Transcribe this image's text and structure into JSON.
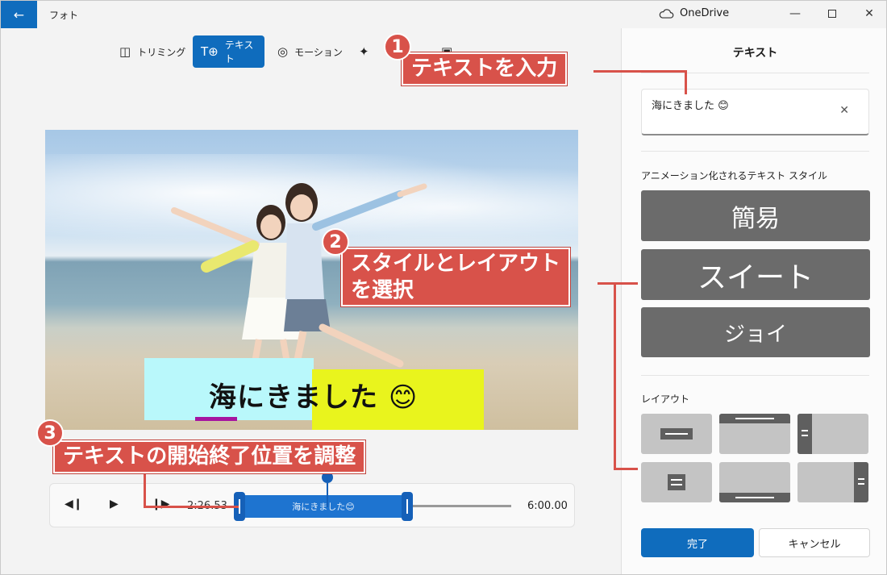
{
  "window": {
    "app_title": "フォト",
    "onedrive_label": "OneDrive"
  },
  "toolbar": {
    "items": [
      {
        "label": "トリミング",
        "icon": "trim-icon",
        "active": false
      },
      {
        "label": "テキスト",
        "icon": "text-icon",
        "active": true
      },
      {
        "label": "モーション",
        "icon": "motion-icon",
        "active": false
      },
      {
        "label": "3D効果",
        "icon": "3d-effects-icon",
        "active": false
      },
      {
        "label": "フィルター",
        "icon": "filter-icon",
        "active": false
      }
    ]
  },
  "preview": {
    "overlay_text": "海にきました",
    "overlay_emoji": "😊",
    "overlay_colors": {
      "left": "#b9f8fb",
      "right": "#e9f41d",
      "underline": "#a614a0"
    }
  },
  "timeline": {
    "current_time": "2:26.53",
    "end_time": "6:00.00",
    "clip_label": "海にきました😊"
  },
  "panel": {
    "title": "テキスト",
    "text_input_value": "海にきました 😊",
    "style_section_label": "アニメーション化されるテキスト スタイル",
    "styles": [
      "簡易",
      "スイート",
      "ジョイ"
    ],
    "layout_section_label": "レイアウト",
    "done_label": "完了",
    "cancel_label": "キャンセル"
  },
  "annotations": {
    "step1": {
      "number": "1",
      "text": "テキストを入力"
    },
    "step2": {
      "number": "2",
      "line1": "スタイルとレイアウト",
      "line2": "を選択"
    },
    "step3": {
      "number": "3",
      "text": "テキストの開始終了位置を調整"
    }
  },
  "colors": {
    "accent": "#0f6cbd",
    "callout": "#d8524a",
    "style_button": "#6b6b6b"
  }
}
